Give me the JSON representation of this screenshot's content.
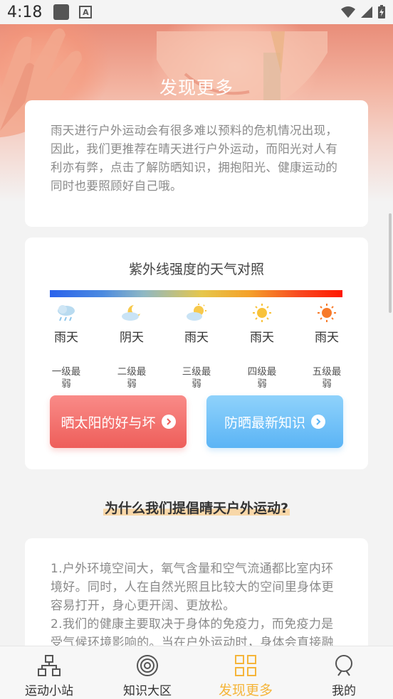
{
  "status_bar": {
    "time": "4:18",
    "a_badge": "A"
  },
  "hero": {
    "title": "发现更多"
  },
  "intro": {
    "text": "雨天进行户外运动会有很多难以预料的危机情况出现，因此，我们更推荐在晴天进行户外运动，而阳光对人有利亦有弊，点击了解防晒知识，拥抱阳光、健康运动的同时也要照顾好自己哦。"
  },
  "uv": {
    "title": "紫外线强度的天气对照",
    "items": [
      {
        "icon": "rain-cloud-icon",
        "weather": "雨天",
        "level_line1": "一级最",
        "level_line2": "弱"
      },
      {
        "icon": "moon-cloud-icon",
        "weather": "阴天",
        "level_line1": "二级最",
        "level_line2": "弱"
      },
      {
        "icon": "partly-sunny-icon",
        "weather": "雨天",
        "level_line1": "三级最",
        "level_line2": "弱"
      },
      {
        "icon": "sun-icon",
        "weather": "雨天",
        "level_line1": "四级最",
        "level_line2": "弱"
      },
      {
        "icon": "hot-sun-icon",
        "weather": "雨天",
        "level_line1": "五级最",
        "level_line2": "弱"
      }
    ],
    "btn_left": "晒太阳的好与坏",
    "btn_right": "防晒最新知识"
  },
  "section": {
    "title": "为什么我们提倡晴天户外运动?"
  },
  "reasons": {
    "p1": "1.户外环境空间大，氧气含量和空气流通都比室内环境好。同时，人在自然光照且比较大的空间里身体更容易打开，身心更开阔、更放松。",
    "p2": "2.我们的健康主要取决于身体的免疫力，而免疫力是受气候环境影响的。当在户外运动时，身体会直接融"
  },
  "nav": {
    "items": [
      {
        "label": "运动小站",
        "icon": "sitemap-icon"
      },
      {
        "label": "知识大区",
        "icon": "target-icon"
      },
      {
        "label": "发现更多",
        "icon": "grid-icon"
      },
      {
        "label": "我的",
        "icon": "person-icon"
      }
    ],
    "active_color": "#f5b53a"
  }
}
